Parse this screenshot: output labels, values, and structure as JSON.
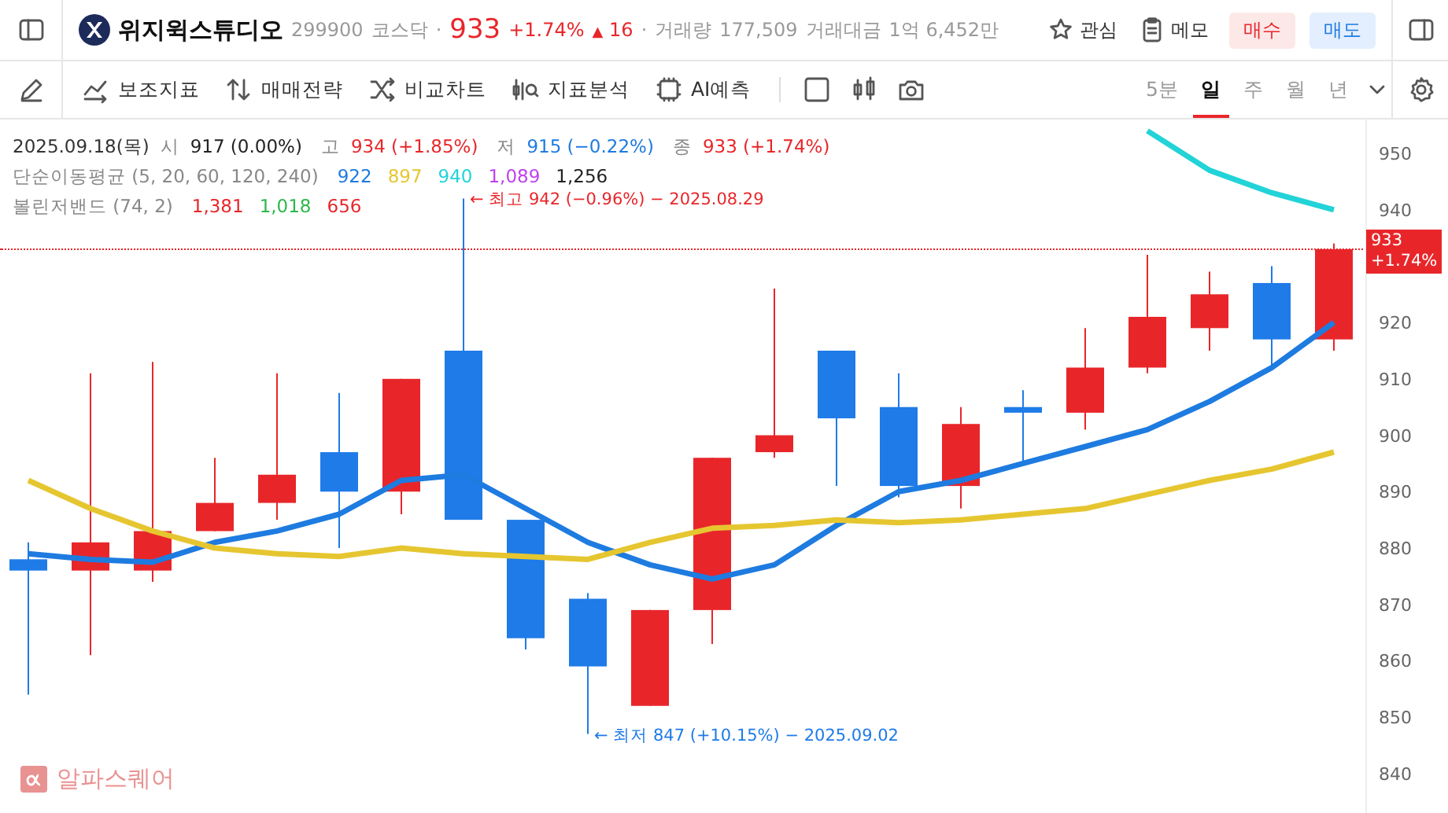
{
  "header": {
    "stock_name": "위지윅스튜디오",
    "code": "299900",
    "market": "코스닥",
    "separator_1": "·",
    "price": "933",
    "change_pct": "+1.74%",
    "change_arrow": "▲",
    "change": "16",
    "separator_2": "·",
    "volume_label": "거래량",
    "volume": "177,509",
    "amount_label": "거래대금",
    "amount": "1억 6,452만",
    "actions": [
      {
        "kind": "favorite",
        "label": "관심"
      },
      {
        "kind": "memo",
        "label": "메모"
      }
    ],
    "buy": "매수",
    "sell": "매도"
  },
  "toolbar": {
    "tools": [
      {
        "kind": "indicator",
        "label": "보조지표"
      },
      {
        "kind": "strategy",
        "label": "매매전략"
      },
      {
        "kind": "compare",
        "label": "비교차트"
      },
      {
        "kind": "analysis",
        "label": "지표분석"
      },
      {
        "kind": "ai",
        "label": "AI예측"
      }
    ],
    "periods": [
      {
        "label": "5분",
        "selected": false
      },
      {
        "label": "일",
        "selected": true
      },
      {
        "label": "주",
        "selected": false
      },
      {
        "label": "월",
        "selected": false
      },
      {
        "label": "년",
        "selected": false
      }
    ]
  },
  "legend": {
    "date": "2025.09.18(목)",
    "ohlc": [
      {
        "label": "시",
        "value": "917 (0.00%)",
        "color": "#222222"
      },
      {
        "label": "고",
        "value": "934 (+1.85%)",
        "color": "#e8262a"
      },
      {
        "label": "저",
        "value": "915 (−0.22%)",
        "color": "#1e7be0"
      },
      {
        "label": "종",
        "value": "933 (+1.74%)",
        "color": "#e8262a"
      }
    ],
    "sma_label": "단순이동평균 (5, 20, 60, 120, 240)",
    "sma_values": [
      {
        "value": "922",
        "color": "#1e7be0"
      },
      {
        "value": "897",
        "color": "#e6c630"
      },
      {
        "value": "940",
        "color": "#22d3d8"
      },
      {
        "value": "1,089",
        "color": "#c040f0"
      },
      {
        "value": "1,256",
        "color": "#222222"
      }
    ],
    "bb_label": "볼린저밴드 (74, 2)",
    "bb_values": [
      {
        "value": "1,381",
        "color": "#e8262a"
      },
      {
        "value": "1,018",
        "color": "#2db84a"
      },
      {
        "value": "656",
        "color": "#e8262a"
      }
    ]
  },
  "chart": {
    "chart_data": {
      "type": "line",
      "ylim": [
        833,
        956
      ],
      "yticks": [
        840,
        850,
        860,
        870,
        880,
        890,
        900,
        910,
        920,
        940,
        950
      ],
      "series": [
        {
          "color": "#1e7be0",
          "values": [
            879,
            878,
            877.5,
            881,
            883,
            886,
            892,
            893,
            887,
            881,
            877,
            874.5,
            877,
            884,
            890,
            892,
            895,
            898,
            901,
            906,
            912,
            920
          ]
        },
        {
          "color": "#e6c630",
          "values": [
            892,
            887,
            883,
            880,
            879,
            878.5,
            880,
            879,
            878.5,
            878,
            881,
            883.5,
            884,
            885,
            884.5,
            885,
            886,
            887,
            889.5,
            892,
            894,
            897
          ]
        },
        {
          "color": "#22d3d8",
          "values": [
            null,
            null,
            null,
            null,
            null,
            null,
            null,
            null,
            null,
            null,
            null,
            null,
            null,
            null,
            null,
            null,
            null,
            null,
            954,
            947,
            943,
            940
          ]
        }
      ],
      "annotations": [
        "← 최고 942 (−0.96%) − 2025.08.29",
        "← 최저 847 (+10.15%) − 2025.09.02"
      ]
    },
    "current_price_label": "933 +1.74%",
    "logo_text": "알파스퀘어"
  }
}
